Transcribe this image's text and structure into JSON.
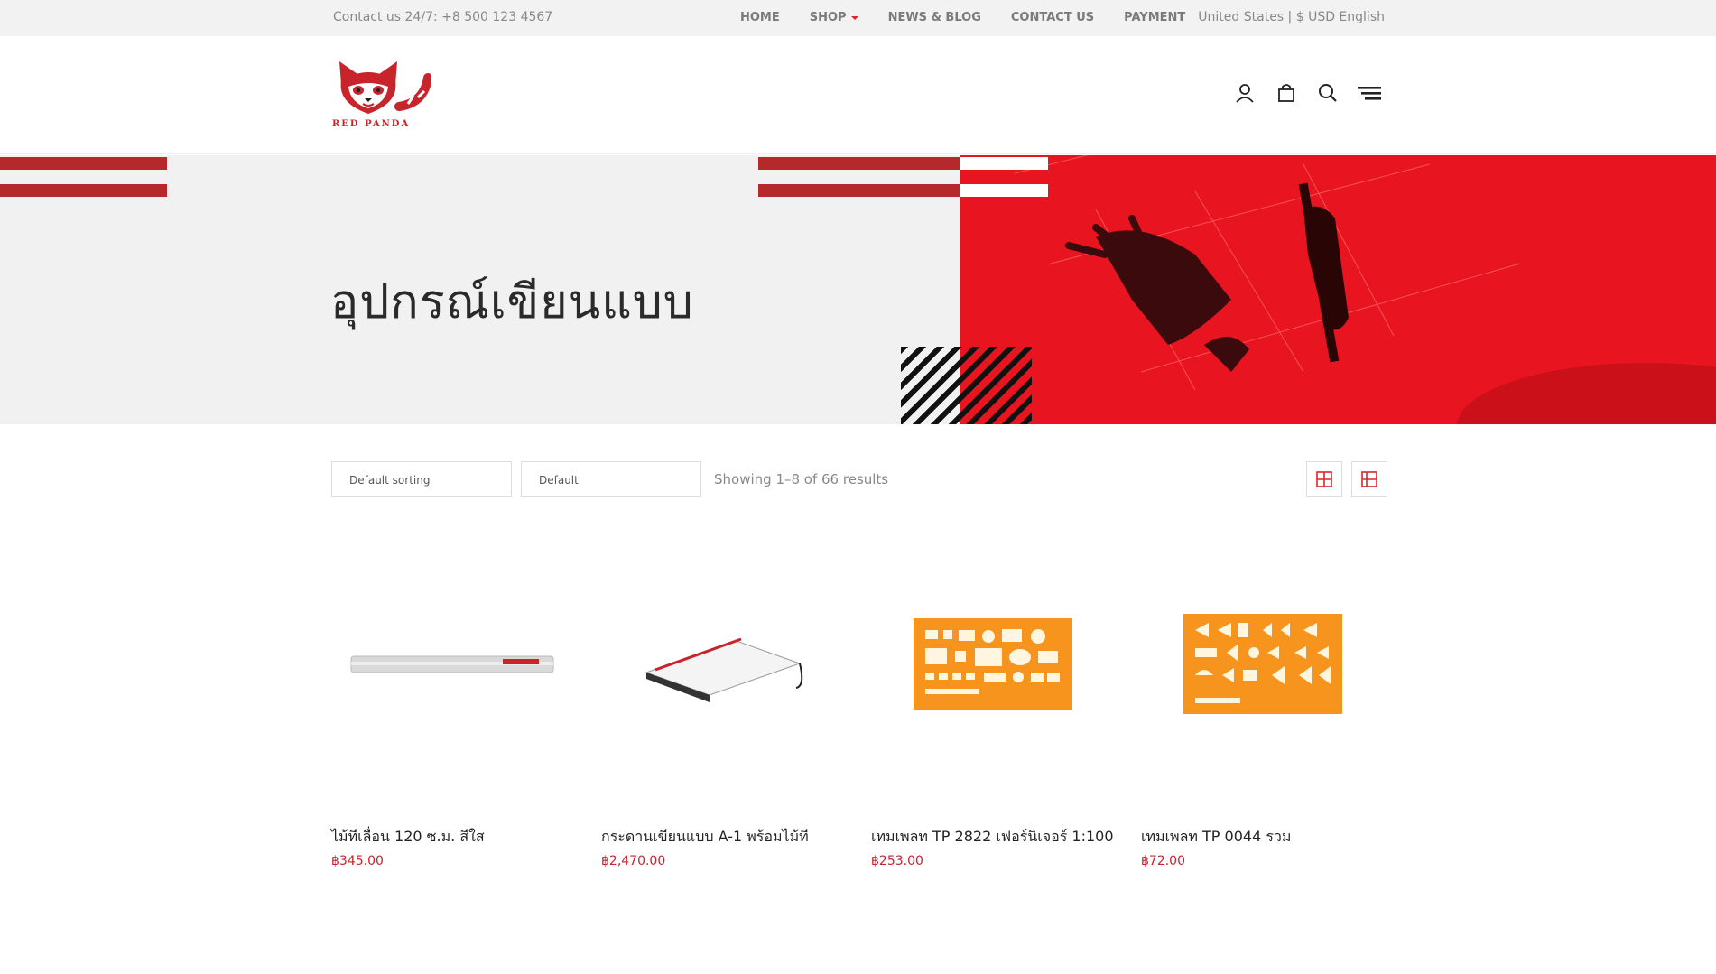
{
  "topbar": {
    "contact": "Contact us 24/7: +8 500 123 4567",
    "nav": [
      {
        "label": "HOME"
      },
      {
        "label": "SHOP"
      },
      {
        "label": "NEWS & BLOG"
      },
      {
        "label": "CONTACT US"
      },
      {
        "label": "PAYMENT"
      }
    ],
    "locale": "United States | $ USD English"
  },
  "header": {
    "logo_text": "RED PANDA",
    "icons": [
      "user-icon",
      "shopping-bag-icon",
      "search-icon",
      "menu-icon"
    ]
  },
  "hero": {
    "title": "อุปกรณ์เขียนแบบ"
  },
  "toolbar": {
    "sort_select": "Default sorting",
    "per_page_select": "Default",
    "results": "Showing 1–8 of 66 results",
    "views": [
      "grid-view-icon",
      "list-view-icon"
    ]
  },
  "products": [
    {
      "title": "ไม้ทีเลื่อน 120 ซ.ม. สีใส",
      "price": "฿345.00"
    },
    {
      "title": "กระดานเขียนแบบ A-1 พร้อมไม้ที",
      "price": "฿2,470.00"
    },
    {
      "title": "เทมเพลท TP 2822 เฟอร์นิเจอร์ 1:100",
      "price": "฿253.00"
    },
    {
      "title": "เทมเพลท TP 0044 รวม",
      "price": "฿72.00"
    }
  ],
  "colors": {
    "accent": "#e8141f",
    "brand_red": "#c8242b",
    "stripe": "#b5282c",
    "topbar_bg": "#f2f2f2",
    "template_orange": "#f7941d"
  }
}
